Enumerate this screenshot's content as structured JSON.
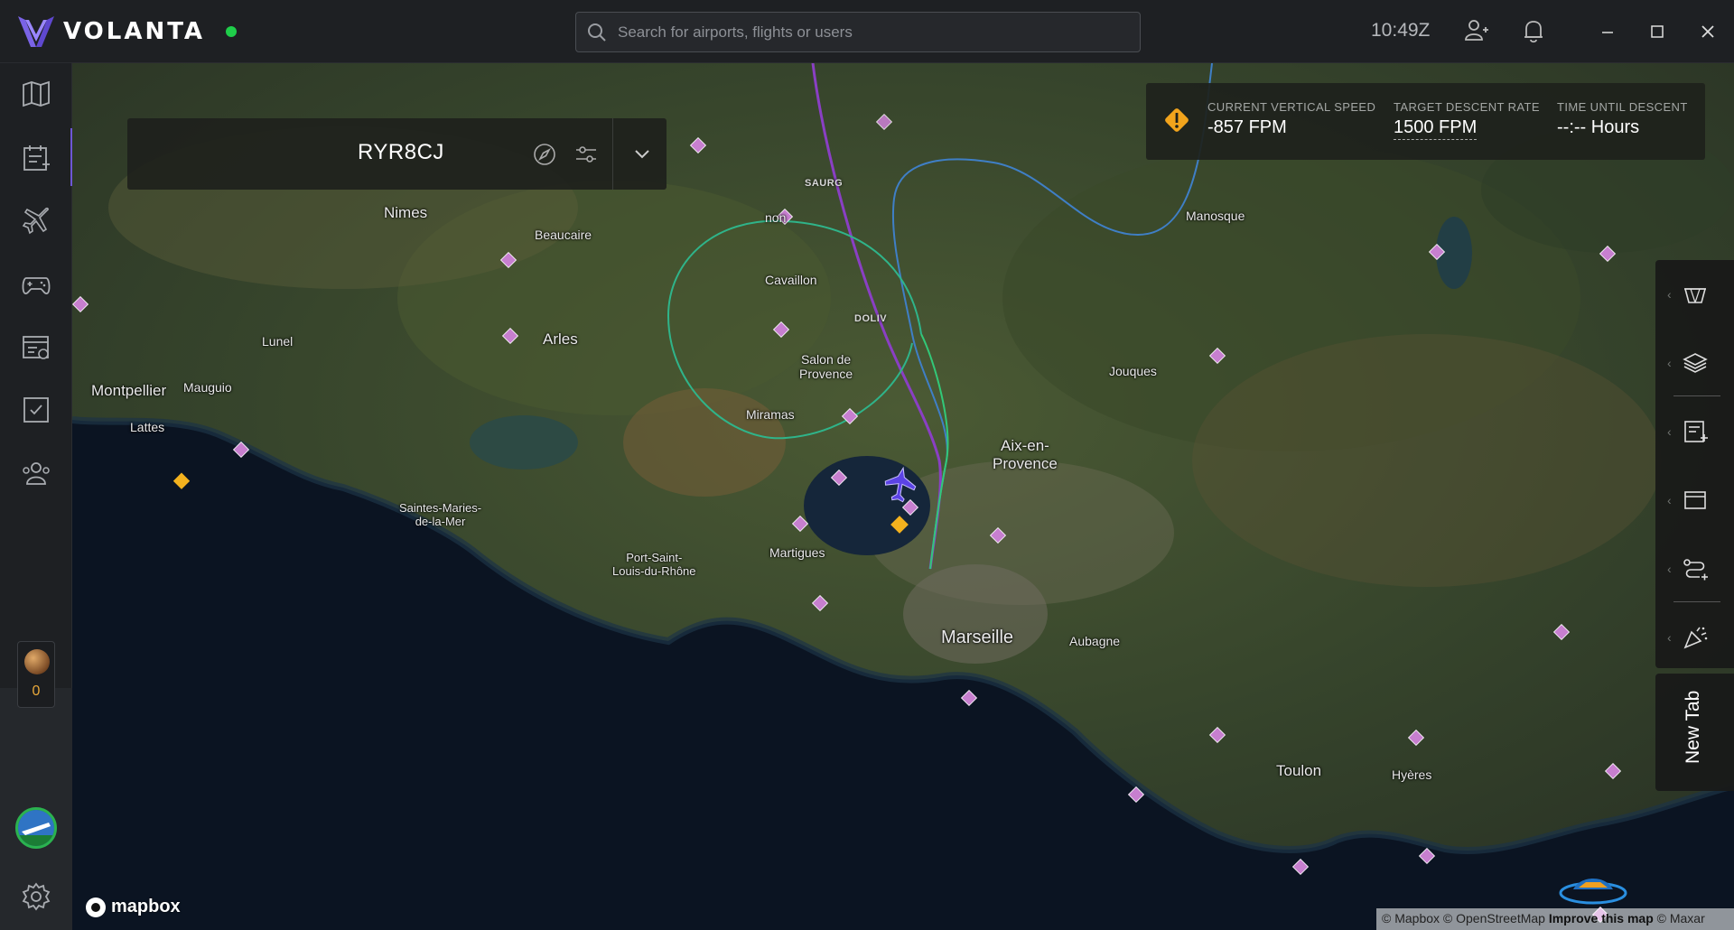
{
  "app": {
    "name": "VOLANTA",
    "status_color": "#1fce4a",
    "accent": "#6e56d6"
  },
  "search": {
    "placeholder": "Search for airports, flights or users"
  },
  "clock": "10:49Z",
  "sidebar": {
    "items": [
      {
        "name": "map-icon"
      },
      {
        "name": "flight-planner-icon"
      },
      {
        "name": "aircraft-icon"
      },
      {
        "name": "gamepad-icon"
      },
      {
        "name": "logbook-icon"
      },
      {
        "name": "checklist-icon"
      },
      {
        "name": "community-icon"
      }
    ],
    "points": "0"
  },
  "flight": {
    "callsign": "RYR8CJ"
  },
  "descent": {
    "vs_label": "CURRENT VERTICAL SPEED",
    "vs_value": "-857 FPM",
    "target_label": "TARGET DESCENT RATE",
    "target_value": "1500 FPM",
    "time_label": "TIME UNTIL DESCENT",
    "time_value": "--:-- Hours",
    "warning_color": "#f2a41c"
  },
  "map": {
    "cities": {
      "nimes": "Nimes",
      "beaucaire": "Beaucaire",
      "lunel": "Lunel",
      "arles": "Arles",
      "montpellier": "Montpellier",
      "mauguio": "Mauguio",
      "lattes": "Lattes",
      "cavaillon": "Cavaillon",
      "salon": "Salon de\nProvence",
      "miramas": "Miramas",
      "saintes": "Saintes-Maries-\nde-la-Mer",
      "port": "Port-Saint-\nLouis-du-Rhône",
      "martigues": "Martigues",
      "marseille": "Marseille",
      "aubagne": "Aubagne",
      "aix": "Aix-en-\nProvence",
      "jouques": "Jouques",
      "manosque": "Manosque",
      "toulon": "Toulon",
      "hyeres": "Hyères",
      "avignon_partial": "non"
    },
    "waypoints": {
      "saurg": "SAURG",
      "doliv": "DOLIV"
    }
  },
  "right_toolbar": {
    "buttons": [
      {
        "name": "airport-basket-icon"
      },
      {
        "name": "layers-icon"
      },
      {
        "name": "notes-add-icon"
      },
      {
        "name": "window-icon"
      },
      {
        "name": "route-add-icon"
      },
      {
        "name": "celebrate-icon"
      }
    ],
    "new_tab": "New Tab"
  },
  "footer": {
    "mapbox": "mapbox",
    "attr_mapbox": "© Mapbox",
    "attr_osm": "© OpenStreetMap",
    "attr_improve": "Improve this map",
    "attr_maxar": "© Maxar"
  }
}
